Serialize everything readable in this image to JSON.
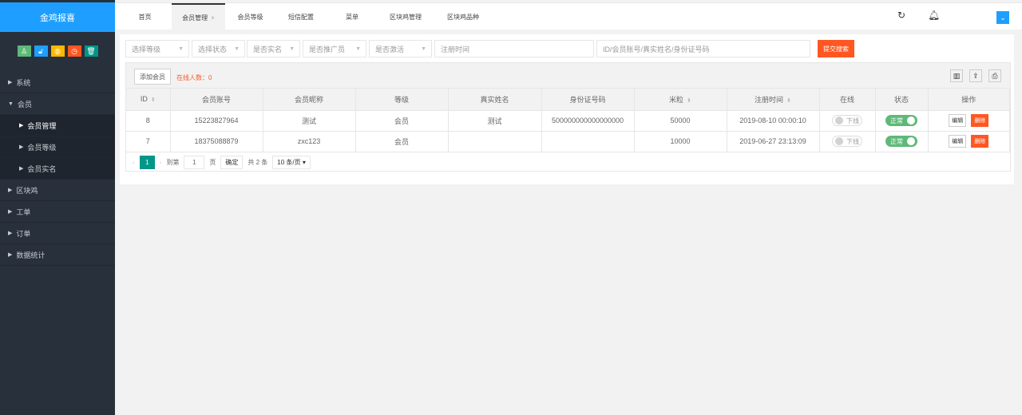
{
  "app": {
    "title": "金鸡报喜"
  },
  "quick_buttons": [
    {
      "icon": "user-icon",
      "color": "#5FB878"
    },
    {
      "icon": "lock-icon",
      "color": "#1E9FFF"
    },
    {
      "icon": "globe-icon",
      "color": "#FFB800"
    },
    {
      "icon": "clock-icon",
      "color": "#FF5722"
    },
    {
      "icon": "trash-icon",
      "color": "#009688"
    }
  ],
  "sidebar": {
    "items": [
      {
        "label": "系统",
        "type": "group",
        "expanded": false
      },
      {
        "label": "会员",
        "type": "group",
        "expanded": true
      },
      {
        "label": "会员管理",
        "type": "sub",
        "active": true
      },
      {
        "label": "会员等级",
        "type": "sub"
      },
      {
        "label": "会员实名",
        "type": "sub"
      },
      {
        "label": "区块鸡",
        "type": "group",
        "expanded": false
      },
      {
        "label": "工单",
        "type": "group",
        "expanded": false
      },
      {
        "label": "订单",
        "type": "group",
        "expanded": false
      },
      {
        "label": "数据统计",
        "type": "group",
        "expanded": false
      }
    ]
  },
  "tabs": [
    {
      "label": "首页"
    },
    {
      "label": "会员管理",
      "active": true,
      "close": "×"
    },
    {
      "label": "会员等级"
    },
    {
      "label": "短信配置"
    },
    {
      "label": "菜单"
    },
    {
      "label": "区块鸡管理"
    },
    {
      "label": "区块鸡品种"
    }
  ],
  "filters": {
    "selects": [
      "选择等级",
      "选择状态",
      "是否实名",
      "是否推广员",
      "是否激活"
    ],
    "date_placeholder": "注册时间",
    "search_placeholder": "ID/会员账号/真实姓名/身份证号码",
    "submit": "提交搜索"
  },
  "toolbar": {
    "add": "添加会员",
    "online": "在线人数：0"
  },
  "table": {
    "columns": [
      "ID",
      "会员账号",
      "会员昵称",
      "等级",
      "真实姓名",
      "身份证号码",
      "米粒",
      "注册时间",
      "在线",
      "状态",
      "操作"
    ],
    "rows": [
      {
        "id": "8",
        "account": "15223827964",
        "nickname": "测试",
        "level": "会员",
        "realname": "测试",
        "idcard": "500000000000000000",
        "mili": "50000",
        "time": "2019-08-10 00:00:10",
        "online": "下线",
        "status": "正常"
      },
      {
        "id": "7",
        "account": "18375088879",
        "nickname": "zxc123",
        "level": "会员",
        "realname": "",
        "idcard": "",
        "mili": "10000",
        "time": "2019-06-27 23:13:09",
        "online": "下线",
        "status": "正常"
      }
    ],
    "edit": "编辑",
    "delete": "删除"
  },
  "pager": {
    "current": "1",
    "goto": "到第",
    "page_input": "1",
    "page_unit": "页",
    "confirm": "确定",
    "total": "共 2 条",
    "per_page": "10 条/页"
  }
}
